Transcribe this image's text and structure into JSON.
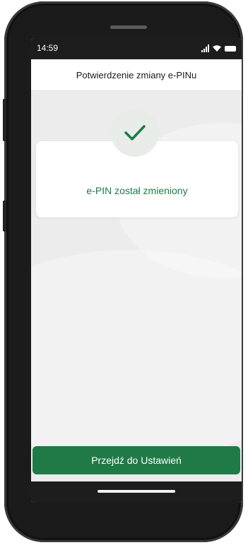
{
  "status_bar": {
    "time": "14:59",
    "icons": [
      "signal-icon",
      "wifi-icon",
      "battery-icon"
    ]
  },
  "header": {
    "title": "Potwierdzenie zmiany e-PINu"
  },
  "confirmation": {
    "icon": "checkmark-icon",
    "message": "e-PIN został zmieniony"
  },
  "action": {
    "button_label": "Przejdź do Ustawień"
  },
  "colors": {
    "accent": "#1f7a47",
    "background": "#ececec",
    "check_circle": "#e8ece9"
  }
}
